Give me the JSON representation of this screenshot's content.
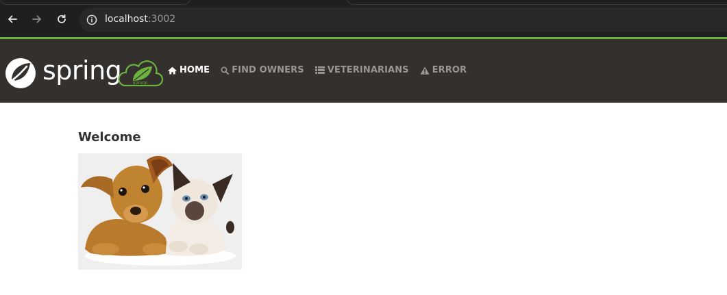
{
  "browser": {
    "url_host": "localhost",
    "url_port": ":3002",
    "back_icon": "arrow-left-icon",
    "forward_icon": "arrow-right-icon",
    "reload_icon": "reload-icon",
    "site_info_icon": "info-icon",
    "accent_color": "#6db33f"
  },
  "navbar": {
    "brand": "spring",
    "background": "#34302d",
    "items": [
      {
        "label": "HOME",
        "icon": "home-icon",
        "active": true
      },
      {
        "label": "FIND OWNERS",
        "icon": "search-icon",
        "active": false
      },
      {
        "label": "VETERINARIANS",
        "icon": "list-icon",
        "active": false
      },
      {
        "label": "ERROR",
        "icon": "warning-icon",
        "active": false
      }
    ]
  },
  "main": {
    "title": "Welcome",
    "image": "pets-image"
  }
}
